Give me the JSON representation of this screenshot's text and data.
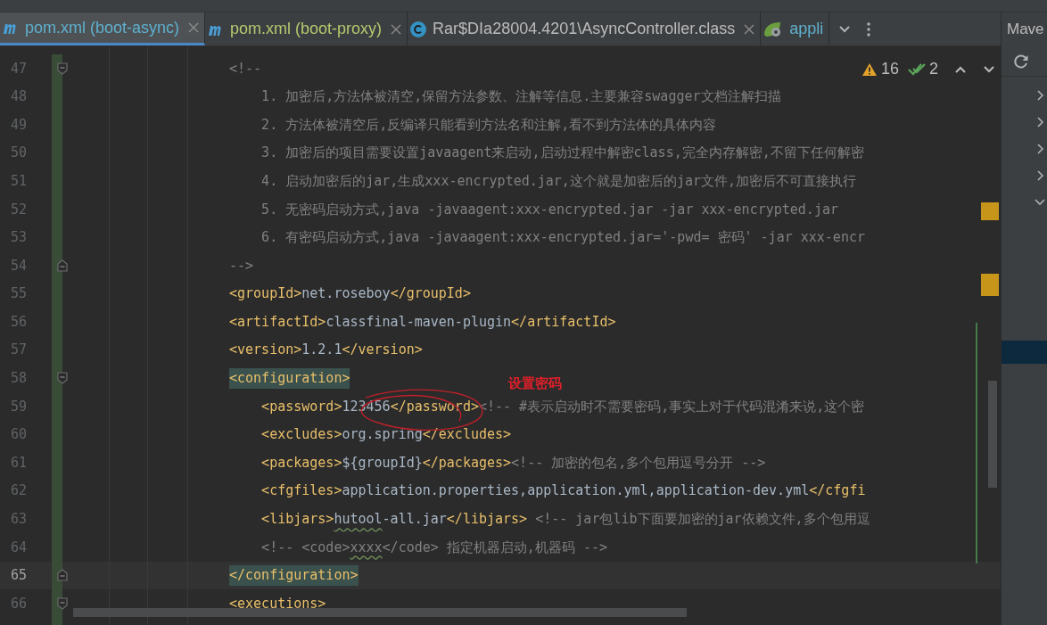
{
  "tabs": [
    {
      "kind": "maven",
      "label": "pom.xml (boot-async)",
      "color": "#5fb0cf",
      "selected": true,
      "closable": true
    },
    {
      "kind": "maven",
      "label": "pom.xml (boot-proxy)",
      "color": "#b7c86e",
      "selected": false,
      "closable": true
    },
    {
      "kind": "class",
      "label": "Rar$DIa28004.4201\\AsyncController.class",
      "color": "#bbbbbb",
      "selected": false,
      "closable": true
    },
    {
      "kind": "spring",
      "label": "appli",
      "color": "#5fb0cf",
      "selected": false,
      "closable": false
    }
  ],
  "side_panel": {
    "title": "Mave",
    "tree": [
      {
        "expanded": false
      },
      {
        "expanded": false
      },
      {
        "expanded": false
      },
      {
        "expanded": false
      },
      {
        "expanded": true
      }
    ]
  },
  "inspections": {
    "warnings": "16",
    "checks": "2"
  },
  "annotation": {
    "label": "设置密码"
  },
  "lines": [
    {
      "number": "47",
      "kind": "fold-start",
      "current": false,
      "segments": [
        {
          "kind": "comment",
          "text": "<!--"
        }
      ]
    },
    {
      "number": "48",
      "current": false,
      "segments": [
        {
          "kind": "comment",
          "text": "    1. 加密后,方法体被清空,保留方法参数、注解等信息.主要兼容swagger文档注解扫描"
        }
      ]
    },
    {
      "number": "49",
      "current": false,
      "segments": [
        {
          "kind": "comment",
          "text": "    2. 方法体被清空后,反编译只能看到方法名和注解,看不到方法体的具体内容"
        }
      ]
    },
    {
      "number": "50",
      "current": false,
      "segments": [
        {
          "kind": "comment",
          "text": "    3. 加密后的项目需要设置javaagent来启动,启动过程中解密class,完全内存解密,不留下任何解密"
        }
      ]
    },
    {
      "number": "51",
      "current": false,
      "segments": [
        {
          "kind": "comment",
          "text": "    4. 启动加密后的jar,生成xxx-encrypted.jar,这个就是加密后的jar文件,加密后不可直接执行"
        }
      ]
    },
    {
      "number": "52",
      "current": false,
      "segments": [
        {
          "kind": "comment",
          "text": "    5. 无密码启动方式,java -javaagent:xxx-encrypted.jar -jar xxx-encrypted.jar"
        }
      ]
    },
    {
      "number": "53",
      "current": false,
      "segments": [
        {
          "kind": "comment",
          "text": "    6. 有密码启动方式,java -javaagent:xxx-encrypted.jar='-pwd= 密码' -jar xxx-encr"
        }
      ]
    },
    {
      "number": "54",
      "kind": "fold-end",
      "current": false,
      "segments": [
        {
          "kind": "comment",
          "text": "-->"
        }
      ]
    },
    {
      "number": "55",
      "current": false,
      "segments": [
        {
          "kind": "tag",
          "text": "<groupId>"
        },
        {
          "kind": "text",
          "text": "net.roseboy"
        },
        {
          "kind": "tag",
          "text": "</groupId>"
        }
      ]
    },
    {
      "number": "56",
      "current": false,
      "segments": [
        {
          "kind": "tag",
          "text": "<artifactId>"
        },
        {
          "kind": "text",
          "text": "classfinal-maven-plugin"
        },
        {
          "kind": "tag",
          "text": "</artifactId>"
        }
      ]
    },
    {
      "number": "57",
      "current": false,
      "segments": [
        {
          "kind": "tag",
          "text": "<version>"
        },
        {
          "kind": "text",
          "text": "1.2.1"
        },
        {
          "kind": "tag",
          "text": "</version>"
        }
      ]
    },
    {
      "number": "58",
      "kind": "fold-start",
      "current": false,
      "segments": [
        {
          "kind": "tag",
          "text": "<configuration>",
          "highlighted": true
        }
      ]
    },
    {
      "number": "59",
      "current": false,
      "segments": [
        {
          "kind": "tag",
          "text": "    <password>"
        },
        {
          "kind": "text",
          "text": "123456"
        },
        {
          "kind": "tag",
          "text": "</password>"
        },
        {
          "kind": "comment",
          "text": "<!-- #表示启动时不需要密码,事实上对于代码混淆来说,这个密"
        }
      ]
    },
    {
      "number": "60",
      "current": false,
      "segments": [
        {
          "kind": "tag",
          "text": "    <excludes>"
        },
        {
          "kind": "text",
          "text": "org.spring"
        },
        {
          "kind": "tag",
          "text": "</excludes>"
        }
      ]
    },
    {
      "number": "61",
      "current": false,
      "segments": [
        {
          "kind": "tag",
          "text": "    <packages>"
        },
        {
          "kind": "text",
          "text": "${groupId}"
        },
        {
          "kind": "tag",
          "text": "</packages>"
        },
        {
          "kind": "comment",
          "text": "<!-- 加密的包名,多个包用逗号分开 -->"
        }
      ]
    },
    {
      "number": "62",
      "current": false,
      "segments": [
        {
          "kind": "tag",
          "text": "    <cfgfiles>"
        },
        {
          "kind": "text",
          "text": "application.properties,application.yml,application-dev.yml"
        },
        {
          "kind": "tag",
          "text": "</cfgfi"
        }
      ]
    },
    {
      "number": "63",
      "current": false,
      "segments": [
        {
          "kind": "tag",
          "text": "    <libjars>"
        },
        {
          "kind": "text",
          "text": "hutool",
          "underlined": true
        },
        {
          "kind": "text",
          "text": "-all.jar"
        },
        {
          "kind": "tag",
          "text": "</libjars>"
        },
        {
          "kind": "comment",
          "text": " <!-- jar包lib下面要加密的jar依赖文件,多个包用逗"
        }
      ]
    },
    {
      "number": "64",
      "current": false,
      "segments": [
        {
          "kind": "comment",
          "text": "    <!-- <code>"
        },
        {
          "kind": "comment",
          "text": "xxxx",
          "underlined": true
        },
        {
          "kind": "comment",
          "text": "</code> 指定机器启动,机器码 -->"
        }
      ]
    },
    {
      "number": "65",
      "kind": "fold-end",
      "current": true,
      "segments": [
        {
          "kind": "tag",
          "text": "</configuration>",
          "highlighted": true
        }
      ]
    },
    {
      "number": "66",
      "kind": "fold-start",
      "current": false,
      "segments": [
        {
          "kind": "tag",
          "text": "<executions>"
        }
      ]
    }
  ]
}
